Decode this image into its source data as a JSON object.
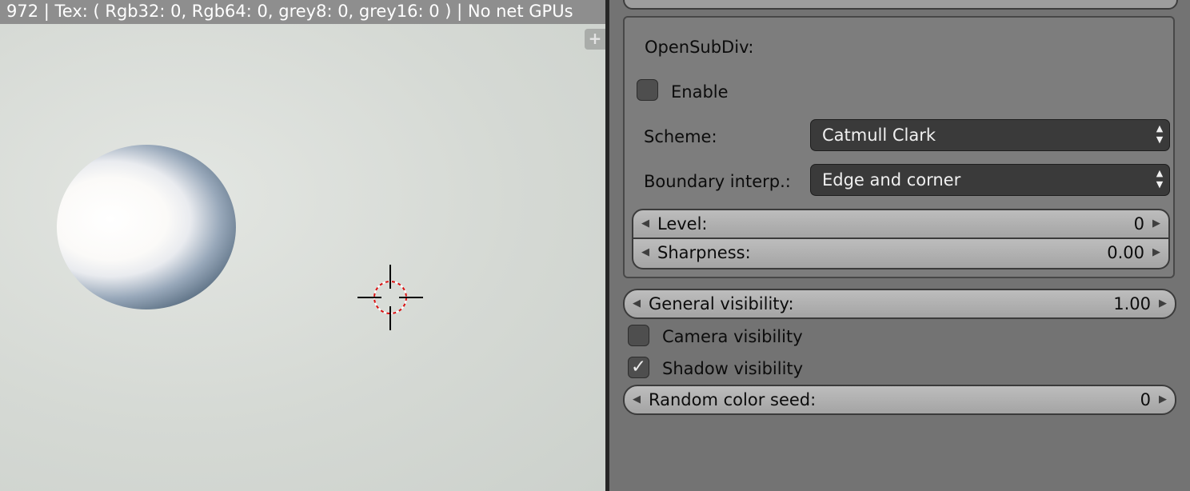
{
  "viewport": {
    "status_text": "972 | Tex: ( Rgb32: 0, Rgb64: 0, grey8: 0, grey16: 0 ) | No net GPUs",
    "plus_label": "+"
  },
  "panel": {
    "section_title": "OpenSubDiv:",
    "enable_label": "Enable",
    "enable_checked": false,
    "scheme_label": "Scheme:",
    "scheme_value": "Catmull Clark",
    "boundary_label": "Boundary interp.:",
    "boundary_value": "Edge and corner",
    "level_label": "Level:",
    "level_value": "0",
    "sharpness_label": "Sharpness:",
    "sharpness_value": "0.00",
    "general_visibility_label": "General visibility:",
    "general_visibility_value": "1.00",
    "camera_visibility_label": "Camera visibility",
    "camera_visibility_checked": false,
    "shadow_visibility_label": "Shadow visibility",
    "shadow_visibility_checked": true,
    "random_color_seed_label": "Random color seed:",
    "random_color_seed_value": "0"
  },
  "glyphs": {
    "check": "✓",
    "arrow_left": "◀",
    "arrow_right": "▶",
    "updown_up": "▲",
    "updown_down": "▼"
  },
  "colors": {
    "panel_bg": "#737373",
    "box_bg": "#7d7d7d",
    "select_bg": "#3a3a3a",
    "slider_bg": "#b0b0b0",
    "viewport_bg": "#d5d9d4",
    "status_bar": "#8e8e8e"
  }
}
